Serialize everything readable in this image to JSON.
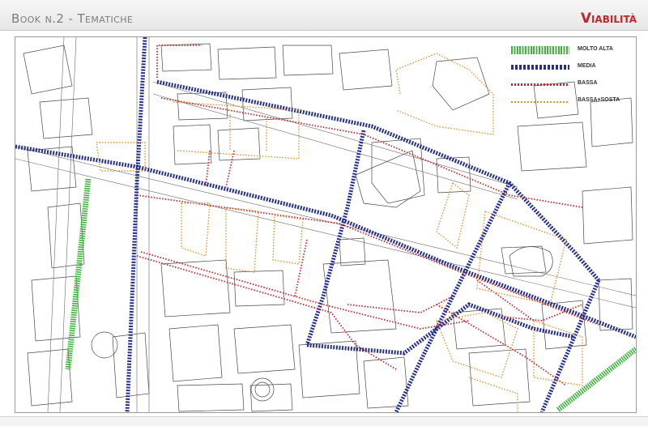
{
  "header": {
    "book_title": "Book n.2 - Tematiche",
    "section_title": "Viabilità"
  },
  "legend": {
    "items": [
      {
        "label": "MOLTO ALTA",
        "color": "#3fb53f",
        "style": "dash-thick"
      },
      {
        "label": "MEDIA",
        "color": "#25308f",
        "style": "dash-medium"
      },
      {
        "label": "BASSA",
        "color": "#d2232a",
        "style": "dot"
      },
      {
        "label": "BASSA+SOSTA",
        "color": "#e8912f",
        "style": "dot-light"
      }
    ]
  },
  "colors": {
    "molto_alta": "#3fb53f",
    "media": "#25308f",
    "bassa": "#d2232a",
    "bassa_sosta": "#e8912f",
    "base_map": "#4a4a4a"
  }
}
